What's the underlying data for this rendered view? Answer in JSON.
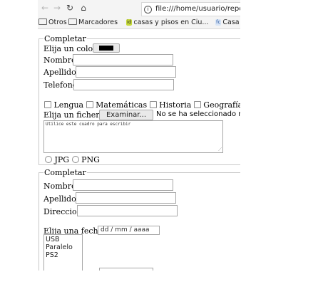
{
  "browser": {
    "icons": [
      "back-arrow-icon",
      "forward-arrow-icon",
      "reload-icon",
      "home-icon",
      "info-icon"
    ],
    "url": "file:///home/usuario/repo"
  },
  "bookmarks": [
    {
      "label": "Otros",
      "icon": "folder-icon"
    },
    {
      "label": "Marcadores",
      "icon": "folder-icon"
    },
    {
      "label": "casas y pisos en Ciu...",
      "icon": "idealista-favicon",
      "badge": "id",
      "badge_color": "#c5d937"
    },
    {
      "label": "Casa",
      "icon": "fotocasa-favicon",
      "badge": "fc",
      "badge_color": "#d8e5f7"
    }
  ],
  "form1": {
    "legend": "Completar",
    "color_label": "Elija un color:",
    "color_value": "#000000",
    "nombre_label": "Nombre",
    "apellidos_label": "Apellidos",
    "telefono_label": "Telefono",
    "subjects": [
      "Lengua",
      "Matemáticas",
      "Historia",
      "Geografía"
    ],
    "file_label": "Elija un fichero:",
    "file_button": "Examinar...",
    "file_status": "No se ha seleccionado ni",
    "textarea_text": "Utilice este cuadro para escribir",
    "formats": [
      "JPG",
      "PNG"
    ]
  },
  "form2": {
    "legend": "Completar",
    "nombre_label": "Nombre",
    "apellidos_label": "Apellidos",
    "direccion_label": "Direccion",
    "date_label": "Elija una fecha:",
    "date_placeholder": "dd / mm / aaaa",
    "options": [
      "USB",
      "Paralelo",
      "PS2"
    ]
  }
}
